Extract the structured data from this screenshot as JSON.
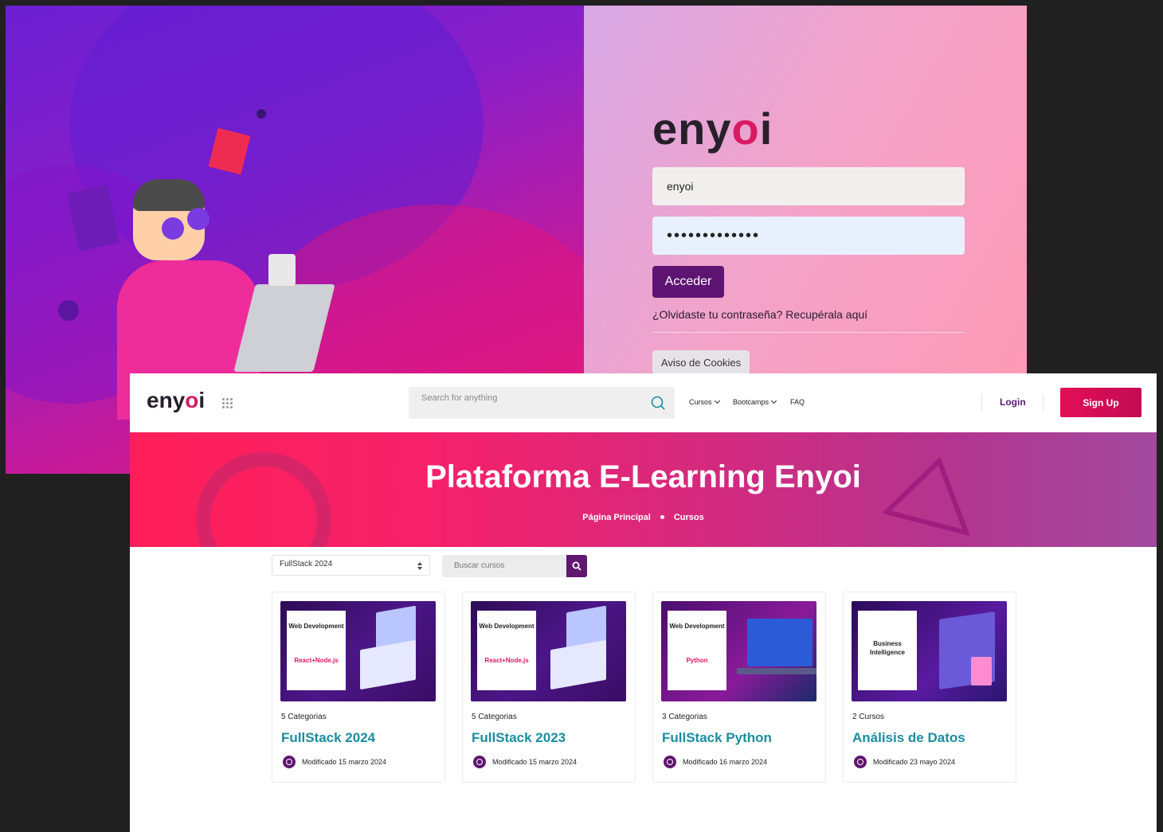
{
  "login": {
    "logo": "enyoi",
    "username_value": "enyoi",
    "password_value": "•••••••••••••",
    "submit_label": "Acceder",
    "forgot_link": "¿Olvidaste tu contraseña? Recupérala aquí",
    "cookies_button": "Aviso de Cookies"
  },
  "header": {
    "logo": "enyoi",
    "search_placeholder": "Search for anything",
    "nav": [
      {
        "label": "Cursos",
        "dropdown": true
      },
      {
        "label": "Bootcamps",
        "dropdown": true
      },
      {
        "label": "FAQ",
        "dropdown": false
      }
    ],
    "login_label": "Login",
    "signup_label": "Sign Up"
  },
  "hero": {
    "title": "Plataforma E-Learning Enyoi",
    "breadcrumb": [
      "Página Principal",
      "Cursos"
    ]
  },
  "filters": {
    "category_selected": "FullStack 2024",
    "search_placeholder": "Buscar cursos"
  },
  "courses": [
    {
      "thumb_title": "Web Development",
      "thumb_sub": "React+Node.js",
      "meta": "5 Categorias",
      "title": "FullStack 2024",
      "modified": "Modificado 15 marzo 2024"
    },
    {
      "thumb_title": "Web Development",
      "thumb_sub": "React+Node.js",
      "meta": "5 Categorias",
      "title": "FullStack 2023",
      "modified": "Modificado 15 marzo 2024"
    },
    {
      "thumb_title": "Web Development",
      "thumb_sub": "Python",
      "meta": "3 Categorias",
      "title": "FullStack Python",
      "modified": "Modificado 16 marzo 2024"
    },
    {
      "thumb_title": "Business Intelligence",
      "thumb_sub": "",
      "meta": "2 Cursos",
      "title": "Análisis de Datos",
      "modified": "Modificado 23 mayo 2024"
    }
  ],
  "colors": {
    "brand_purple": "#5f176f",
    "brand_pink": "#e30f56",
    "title_teal": "#1a8da0"
  }
}
